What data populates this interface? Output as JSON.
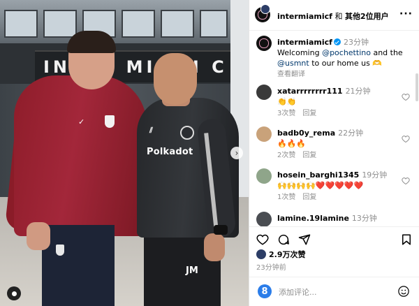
{
  "photo": {
    "banner_text": "INTER MIAMI C",
    "sponsor_text": "Polkadot",
    "jersey_initials": "JM"
  },
  "header": {
    "username": "intermiamicf",
    "joiner": " 和 ",
    "others": "其他2位用户",
    "more_icon": "more-horizontal-icon"
  },
  "caption": {
    "username": "intermiamicf",
    "time": "23分钟",
    "text_before": "Welcoming ",
    "mention1": "@pochettino",
    "text_middle": " and the ",
    "mention2": "@usmnt",
    "text_after": " to our home us 🫶",
    "see_translation": "查看翻译"
  },
  "comments": [
    {
      "username": "xatarrrrrrrr111",
      "time": "21分钟",
      "text": "👏👏",
      "likes": "3次赞",
      "reply": "回复"
    },
    {
      "username": "badb0y_rema",
      "time": "22分钟",
      "text": "🔥🔥🔥",
      "likes": "2次赞",
      "reply": "回复"
    },
    {
      "username": "hosein_barghi1345",
      "time": "19分钟",
      "text": "🙌🙌🙌🙌❤️❤️❤️❤️❤️",
      "likes": "1次赞",
      "reply": "回复"
    },
    {
      "username": "lamine.19lamine",
      "time": "13分钟",
      "text": "",
      "likes": "",
      "reply": ""
    }
  ],
  "actions": {
    "like_icon": "heart-icon",
    "comment_icon": "comment-icon",
    "share_icon": "share-icon",
    "save_icon": "bookmark-icon"
  },
  "likes_count": "2.9万次赞",
  "post_time": "23分钟前",
  "composer": {
    "placeholder": "添加评论...",
    "emoji_icon": "emoji-icon"
  },
  "colors": {
    "link": "#00376b",
    "verified": "#0095f6",
    "muted": "#8e8e8e"
  }
}
